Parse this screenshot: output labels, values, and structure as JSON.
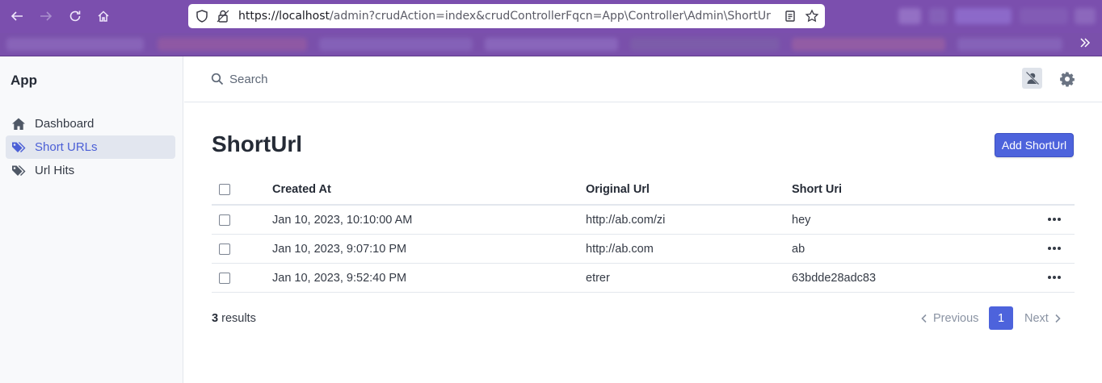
{
  "browser": {
    "url_host": "https://localhost",
    "url_rest": "/admin?crudAction=index&crudControllerFqcn=App\\Controller\\Admin\\ShortUr"
  },
  "sidebar": {
    "brand": "App",
    "items": [
      {
        "label": "Dashboard",
        "icon": "home-icon",
        "active": false
      },
      {
        "label": "Short URLs",
        "icon": "tags-icon",
        "active": true
      },
      {
        "label": "Url Hits",
        "icon": "tags-icon",
        "active": false
      }
    ]
  },
  "search": {
    "placeholder": "Search",
    "value": ""
  },
  "main": {
    "title": "ShortUrl",
    "add_label": "Add ShortUrl"
  },
  "table": {
    "columns": [
      "Created At",
      "Original Url",
      "Short Uri"
    ],
    "rows": [
      [
        "Jan 10, 2023, 10:10:00 AM",
        "http://ab.com/zi",
        "hey"
      ],
      [
        "Jan 10, 2023, 9:07:10 PM",
        "http://ab.com",
        "ab"
      ],
      [
        "Jan 10, 2023, 9:52:40 PM",
        "etrer",
        "63bdde28adc83"
      ]
    ]
  },
  "footer": {
    "results_count": "3",
    "results_label": "results",
    "previous_label": "Previous",
    "current_page": "1",
    "next_label": "Next"
  },
  "colors": {
    "accent": "#4d63dc",
    "browser": "#7b4fae"
  }
}
